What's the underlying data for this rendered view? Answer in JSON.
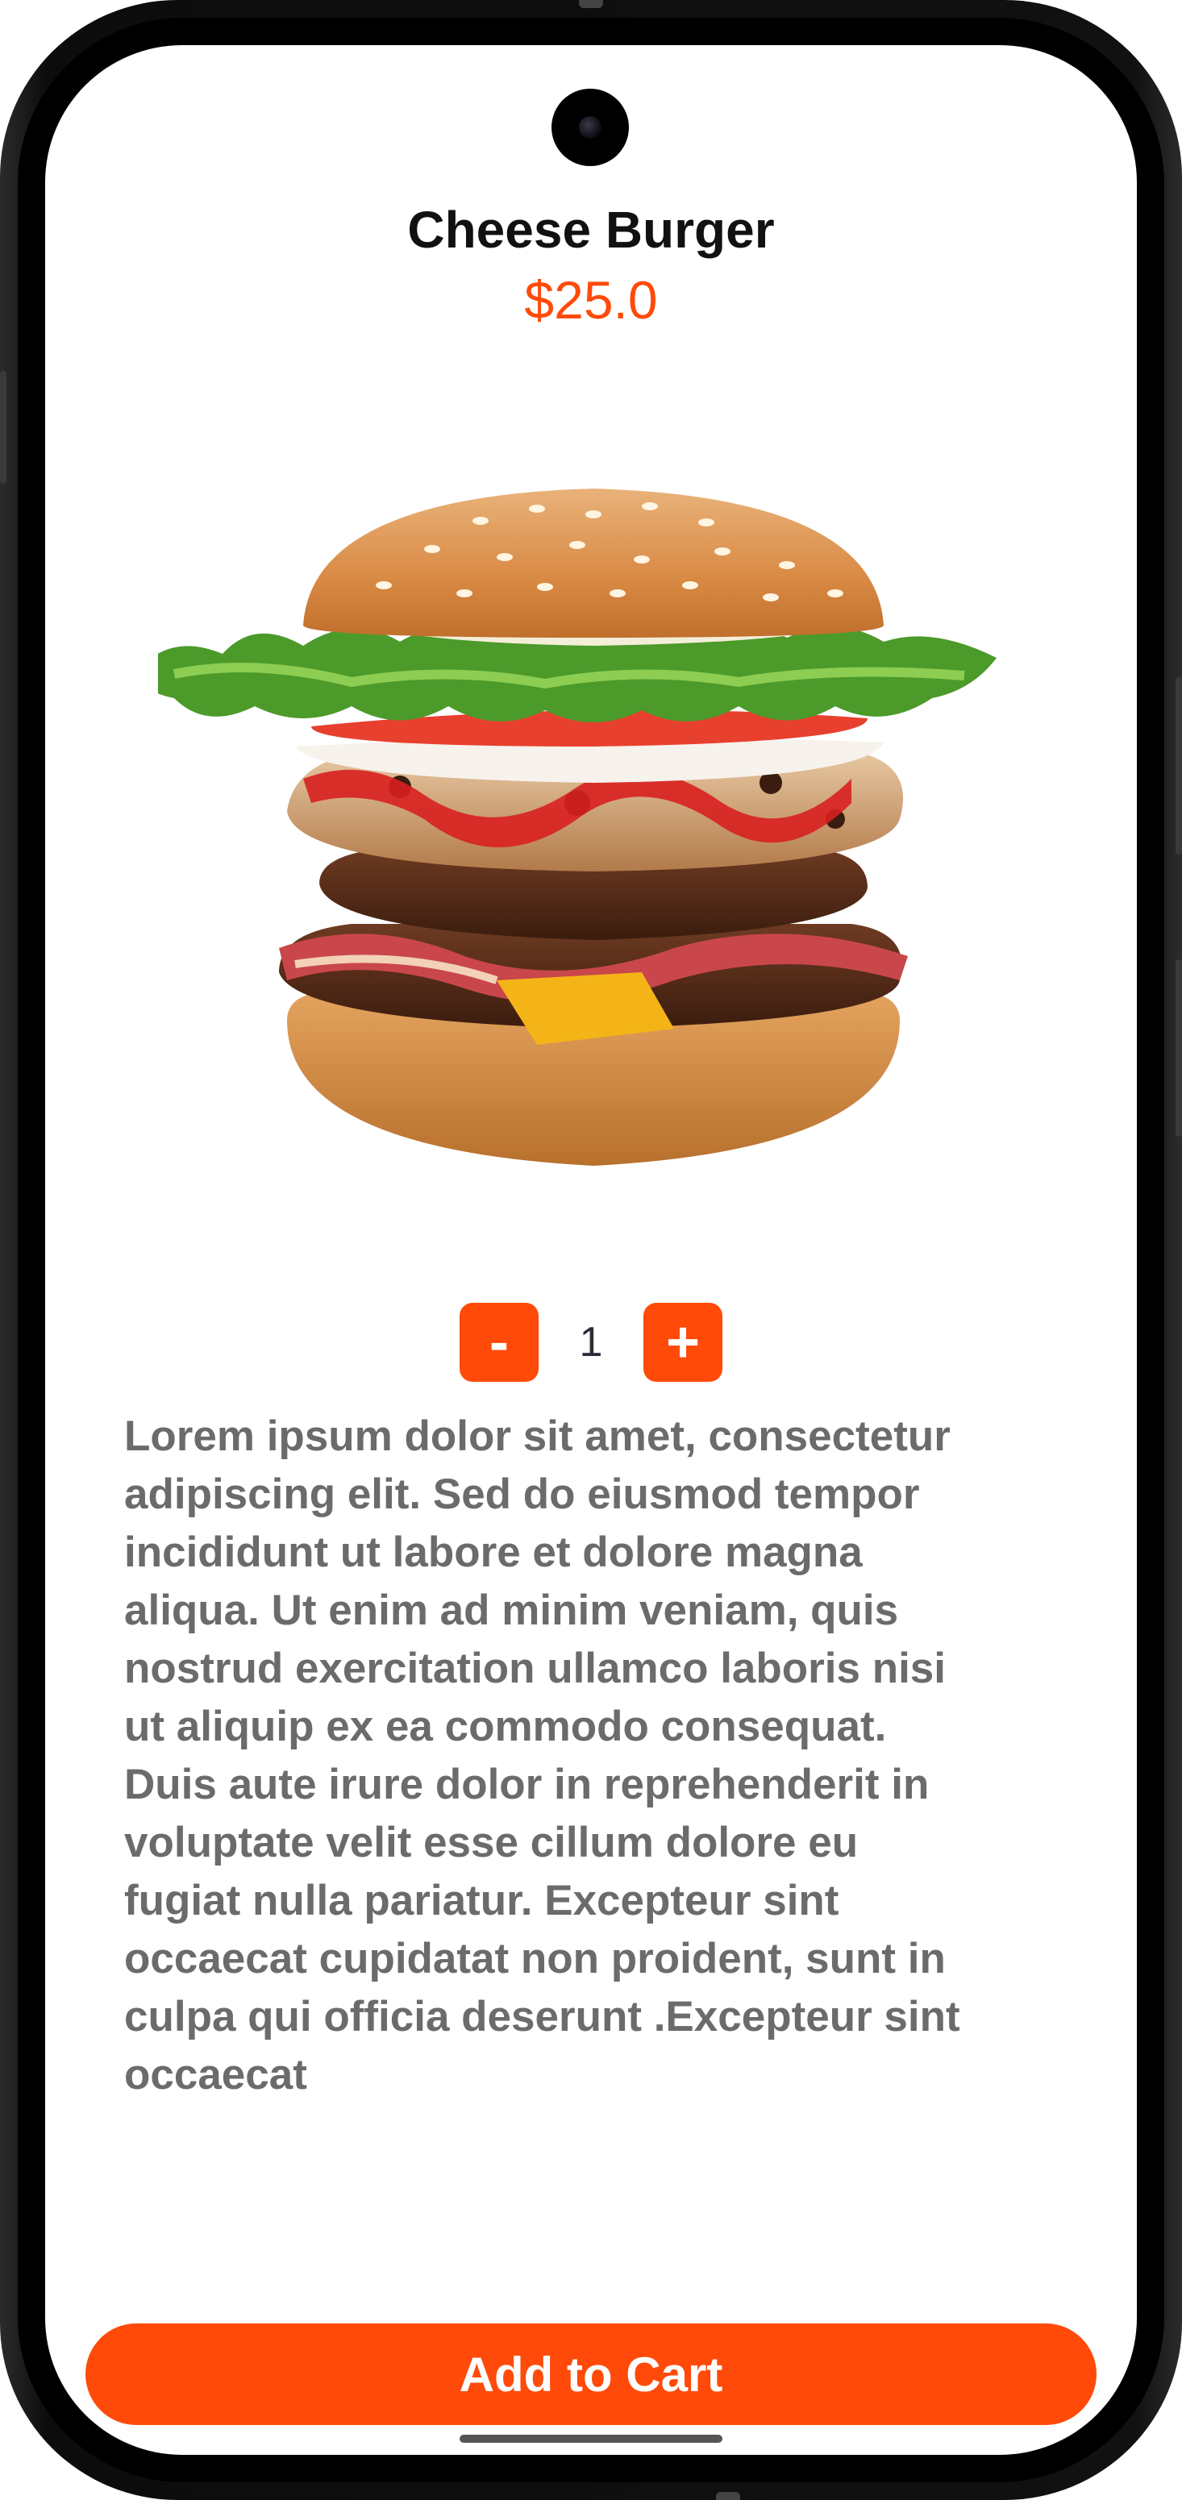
{
  "product": {
    "name": "Cheese Burger",
    "price": "$25.0",
    "image_alt": "burger-image"
  },
  "quantity": {
    "minus_label": "-",
    "value": "1",
    "plus_label": "+"
  },
  "description": "Lorem ipsum dolor sit amet, consectetur\nadipiscing elit. Sed  do eiusmod tempor\nincididunt ut labore et dolore magna\naliqua. Ut enim ad minim veniam, quis\nnostrud exercitation  ullamco laboris nisi\nut aliquip ex ea commodo consequat.\nDuis aute irure dolor in reprehenderit in\nvoluptate velit esse  cillum dolore eu\nfugiat nulla pariatur. Excepteur sint\noccaecat  cupidatat non proident, sunt in\nculpa qui officia deserunt .Excepteur sint\noccaecat",
  "cart_button": {
    "label": "Add to Cart"
  },
  "colors": {
    "accent": "#ff4a0a",
    "title": "#111111",
    "description": "#6b6b6b"
  }
}
